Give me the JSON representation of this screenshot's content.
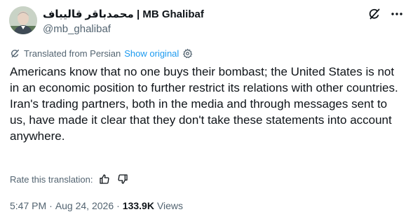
{
  "author": {
    "display_name": "محمدباقر قالیباف | MB Ghalibaf",
    "handle": "@mb_ghalibaf"
  },
  "translation": {
    "notice": "Translated from Persian",
    "show_original": "Show original"
  },
  "tweet": {
    "paragraph_1": "Americans know that no one buys their bombast; the United States is not in an economic position to further restrict its relations with other countries.",
    "paragraph_2": "Iran's trading partners, both in the media and through messages sent to us, have made it clear that they don't take these statements into account anywhere."
  },
  "rating": {
    "label": "Rate this translation:"
  },
  "meta": {
    "time": "5:47 PM",
    "date": "Aug 24, 2026",
    "separator": "·",
    "views_count": "133.9K",
    "views_label": "Views"
  },
  "icons": {
    "grok": "grok-icon",
    "more": "more-icon",
    "translate": "translate-icon",
    "settings": "gear-icon",
    "thumbs_up": "thumbs-up-icon",
    "thumbs_down": "thumbs-down-icon"
  },
  "colors": {
    "text": "#0f1419",
    "muted": "#536471",
    "link": "#1d9bf0"
  }
}
